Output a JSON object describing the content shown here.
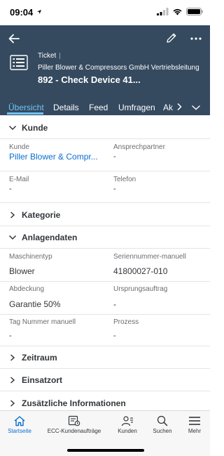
{
  "status_bar": {
    "time": "09:04"
  },
  "header": {
    "object_type": "Ticket",
    "company": "Piller Blower & Compressors GmbH Vertriebsleitung",
    "title": "892 - Check Device 41...",
    "icons": {
      "back": "back-arrow-icon",
      "edit": "pencil-icon",
      "more": "more-icon"
    }
  },
  "tabs": [
    {
      "label": "Übersicht",
      "active": true
    },
    {
      "label": "Details"
    },
    {
      "label": "Feed"
    },
    {
      "label": "Umfragen"
    },
    {
      "label": "Ak"
    }
  ],
  "sections": {
    "kunde": {
      "title": "Kunde",
      "fields": {
        "kunde": {
          "label": "Kunde",
          "value": "Piller Blower & Compr..."
        },
        "ansprechpartner": {
          "label": "Ansprechpartner",
          "value": "-"
        },
        "email": {
          "label": "E-Mail",
          "value": "-"
        },
        "telefon": {
          "label": "Telefon",
          "value": "-"
        }
      }
    },
    "kategorie": {
      "title": "Kategorie"
    },
    "anlagendaten": {
      "title": "Anlagendaten",
      "fields": {
        "maschinentyp": {
          "label": "Maschinentyp",
          "value": "Blower"
        },
        "seriennummer": {
          "label": "Seriennummer-manuell",
          "value": "41800027-010"
        },
        "abdeckung": {
          "label": "Abdeckung",
          "value": "Garantie 50%"
        },
        "ursprungsauftrag": {
          "label": "Ursprungsauftrag",
          "value": "-"
        },
        "tag_nummer": {
          "label": "Tag Nummer manuell",
          "value": "-"
        },
        "prozess": {
          "label": "Prozess",
          "value": "-"
        }
      }
    },
    "zeitraum": {
      "title": "Zeitraum"
    },
    "einsatzort": {
      "title": "Einsatzort"
    },
    "zusaetzliche": {
      "title": "Zusätzliche Informationen"
    }
  },
  "bottom_nav": [
    {
      "label": "Startseite",
      "icon": "home-icon",
      "active": true
    },
    {
      "label": "ECC-Kundenaufträge",
      "icon": "orders-icon"
    },
    {
      "label": "Kunden",
      "icon": "customers-icon"
    },
    {
      "label": "Suchen",
      "icon": "search-icon"
    },
    {
      "label": "Mehr",
      "icon": "menu-icon"
    }
  ],
  "colors": {
    "header_bg": "#354a5f",
    "active_tab": "#6fc3f7",
    "link": "#0a6ed1",
    "text": "#32363a",
    "label": "#6a6d70"
  }
}
